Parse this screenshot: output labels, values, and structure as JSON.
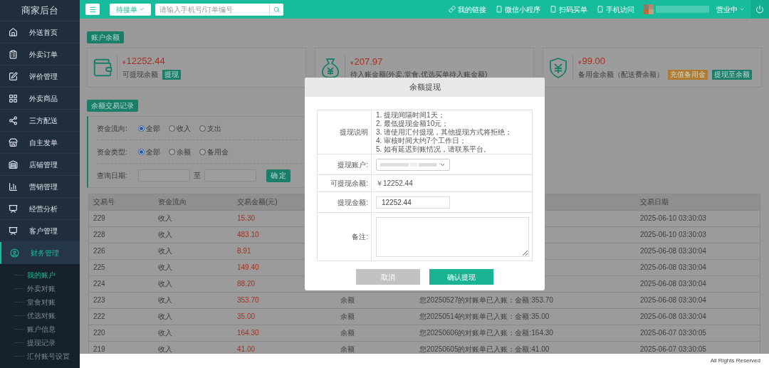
{
  "sidebar": {
    "title": "商家后台",
    "items": [
      {
        "label": "外送首页",
        "selected": false
      },
      {
        "label": "外卖订单",
        "selected": false
      },
      {
        "label": "评价管理",
        "selected": false
      },
      {
        "label": "外卖商品",
        "selected": false
      },
      {
        "label": "三方配送",
        "selected": false
      },
      {
        "label": "自主发单",
        "selected": false
      },
      {
        "label": "店铺管理",
        "selected": false
      },
      {
        "label": "营销管理",
        "selected": false
      },
      {
        "label": "经营分析",
        "selected": false
      },
      {
        "label": "客户管理",
        "selected": false
      },
      {
        "label": "财务管理",
        "selected": true,
        "children": [
          {
            "label": "我的账户",
            "selected": true
          },
          {
            "label": "外卖对账",
            "selected": false
          },
          {
            "label": "堂食对账",
            "selected": false
          },
          {
            "label": "优选对账",
            "selected": false
          },
          {
            "label": "账户信息",
            "selected": false
          },
          {
            "label": "提现记录",
            "selected": false
          },
          {
            "label": "汇付账号设置",
            "selected": false
          }
        ]
      }
    ]
  },
  "topbar": {
    "order_filter": "待接单",
    "search_placeholder": "请输入手机号/订单编号",
    "links": [
      {
        "label": "我的链接",
        "kind": "link"
      },
      {
        "label": "微信小程序",
        "kind": "phone"
      },
      {
        "label": "扫码买单",
        "kind": "phone"
      },
      {
        "label": "手机访问",
        "kind": "phone"
      }
    ],
    "status": "营业中"
  },
  "balance_section": {
    "title": "账户余额",
    "cards": [
      {
        "kind": "wallet",
        "currency": "¥",
        "amount": "12252.44",
        "label": "可提现余额",
        "buttons": [
          {
            "label": "提现",
            "color": "#1b7e69"
          }
        ]
      },
      {
        "kind": "bag",
        "currency": "¥",
        "amount": "207.97",
        "label": "待入账金额(外卖,堂食,优选买单待入账金额)"
      },
      {
        "kind": "shield",
        "currency": "¥",
        "amount": "99.00",
        "label": "备用金余额（配送费余额）",
        "buttons": [
          {
            "label": "充值备用金",
            "color": "#b07a30"
          },
          {
            "label": "提现至余额",
            "color": "#1b7e69"
          }
        ]
      }
    ]
  },
  "records_section": {
    "title": "余额交易记录",
    "filters": [
      {
        "label": "资金流向:",
        "options": [
          {
            "label": "全部",
            "selected": true
          },
          {
            "label": "收入",
            "selected": false
          },
          {
            "label": "支出",
            "selected": false
          }
        ]
      },
      {
        "label": "资金类型:",
        "options": [
          {
            "label": "全部",
            "selected": true
          },
          {
            "label": "余额",
            "selected": false
          },
          {
            "label": "备用金",
            "selected": false
          }
        ]
      }
    ],
    "date": {
      "label": "查询日期:",
      "separator": "至",
      "button": "确 定"
    }
  },
  "table": {
    "columns": [
      "交易号",
      "资金流向",
      "交易金额(元)",
      "交易日期"
    ],
    "rows": [
      {
        "id": "229",
        "flow": "收入",
        "amount": "15.30",
        "date": "2025-06-10 03:30:03"
      },
      {
        "id": "228",
        "flow": "收入",
        "amount": "483.10",
        "date": "2025-06-10 03:30:03"
      },
      {
        "id": "226",
        "flow": "收入",
        "amount": "8.91",
        "date": "2025-06-08 03:30:04"
      },
      {
        "id": "225",
        "flow": "收入",
        "amount": "149.40",
        "date": "2025-06-08 03:30:04"
      },
      {
        "id": "224",
        "flow": "收入",
        "amount": "88.20",
        "date": "2025-06-08 03:30:04"
      },
      {
        "id": "223",
        "flow": "收入",
        "amount": "353.70",
        "type": "余额",
        "note": "您20250527的对账单已入账：金额:353.70",
        "date": "2025-06-08 03:30:04"
      },
      {
        "id": "222",
        "flow": "收入",
        "amount": "35.00",
        "type": "余额",
        "note": "您20250514的对账单已入账：金额:35.00",
        "date": "2025-06-08 03:30:04"
      },
      {
        "id": "220",
        "flow": "收入",
        "amount": "164.30",
        "type": "余额",
        "note": "您20250606的对账单已入账：金额:164.30",
        "date": "2025-06-07 03:30:05"
      },
      {
        "id": "219",
        "flow": "收入",
        "amount": "41.00",
        "type": "余额",
        "note": "您20250605的对账单已入账：金额:41.00",
        "date": "2025-06-07 03:30:05"
      }
    ]
  },
  "modal": {
    "title": "余额提现",
    "rows": [
      {
        "kind": "notes",
        "label": "提现说明",
        "lines": [
          "1. 提现间隔时间1天；",
          "2. 最低提现金额10元；",
          "3. 请使用汇付提现，其他提现方式将拒绝；",
          "4. 审核时间大约7个工作日；",
          "5. 如有延迟到账情况，请联系平台。"
        ]
      },
      {
        "kind": "select",
        "label": "提现账户:"
      },
      {
        "kind": "text",
        "label": "可提现余额:",
        "value": "￥12252.44"
      },
      {
        "kind": "input",
        "label": "提现金额:",
        "value": "12252.44"
      },
      {
        "kind": "textarea",
        "label": "备注:"
      }
    ],
    "buttons": [
      {
        "kind": "cancel",
        "label": "取消"
      },
      {
        "kind": "primary",
        "label": "确认提现"
      }
    ]
  },
  "footer": "All Rights Reserved"
}
